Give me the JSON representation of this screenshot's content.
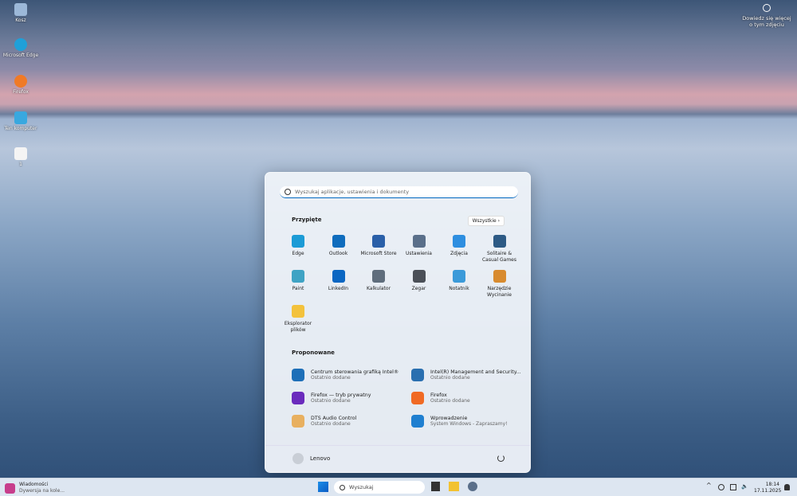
{
  "desktop": {
    "icons": [
      {
        "label": "Kosz",
        "color": "#9cb8d8"
      },
      {
        "label": "Microsoft Edge",
        "color": "#1fa0d8"
      },
      {
        "label": "Firefox",
        "color": "#f07a26"
      },
      {
        "label": "Ten komputer",
        "color": "#39a8df"
      },
      {
        "label": "1",
        "color": "#f4f4f4"
      }
    ],
    "spotlight": "Dowiedz się więcej o tym zdjęciu"
  },
  "start": {
    "search_placeholder": "Wyszukaj aplikacje, ustawienia i dokumenty",
    "pinned_title": "Przypięte",
    "all_label": "Wszystkie",
    "pinned": [
      {
        "label": "Edge",
        "color": "#1c9bd6"
      },
      {
        "label": "Outlook",
        "color": "#0f6cbd"
      },
      {
        "label": "Microsoft Store",
        "color": "#2a5fa8"
      },
      {
        "label": "Ustawienia",
        "color": "#5a6f8a"
      },
      {
        "label": "Zdjęcia",
        "color": "#2e8ee0"
      },
      {
        "label": "Solitaire & Casual Games",
        "color": "#2d5a85"
      },
      {
        "label": "Paint",
        "color": "#3fa3c4"
      },
      {
        "label": "LinkedIn",
        "color": "#0a66c2"
      },
      {
        "label": "Kalkulator",
        "color": "#5f6d7c"
      },
      {
        "label": "Zegar",
        "color": "#4a4f57"
      },
      {
        "label": "Notatnik",
        "color": "#3b9ad9"
      },
      {
        "label": "Narzędzie Wycinanie",
        "color": "#d88b2f"
      },
      {
        "label": "Eksplorator plików",
        "color": "#f3c23c"
      }
    ],
    "recommended_title": "Proponowane",
    "recommended": [
      {
        "title": "Centrum sterowania grafiką Intel®",
        "sub": "Ostatnio dodane",
        "color": "#1e6fb8"
      },
      {
        "title": "Intel(R) Management and Security...",
        "sub": "Ostatnio dodane",
        "color": "#2a6fb0"
      },
      {
        "title": "Firefox — tryb prywatny",
        "sub": "Ostatnio dodane",
        "color": "#6a2bbd"
      },
      {
        "title": "Firefox",
        "sub": "Ostatnio dodane",
        "color": "#f06a24"
      },
      {
        "title": "DTS Audio Control",
        "sub": "Ostatnio dodane",
        "color": "#e8b060"
      },
      {
        "title": "Wprowadzenie",
        "sub": "System Windows - Zapraszamy!",
        "color": "#1f7fd0"
      }
    ],
    "user": "Lenovo"
  },
  "taskbar": {
    "widget_title": "Wiadomości",
    "widget_sub": "Dywersja na kole...",
    "search": "Wyszukaj",
    "time": "18:14",
    "date": "17.11.2025"
  }
}
